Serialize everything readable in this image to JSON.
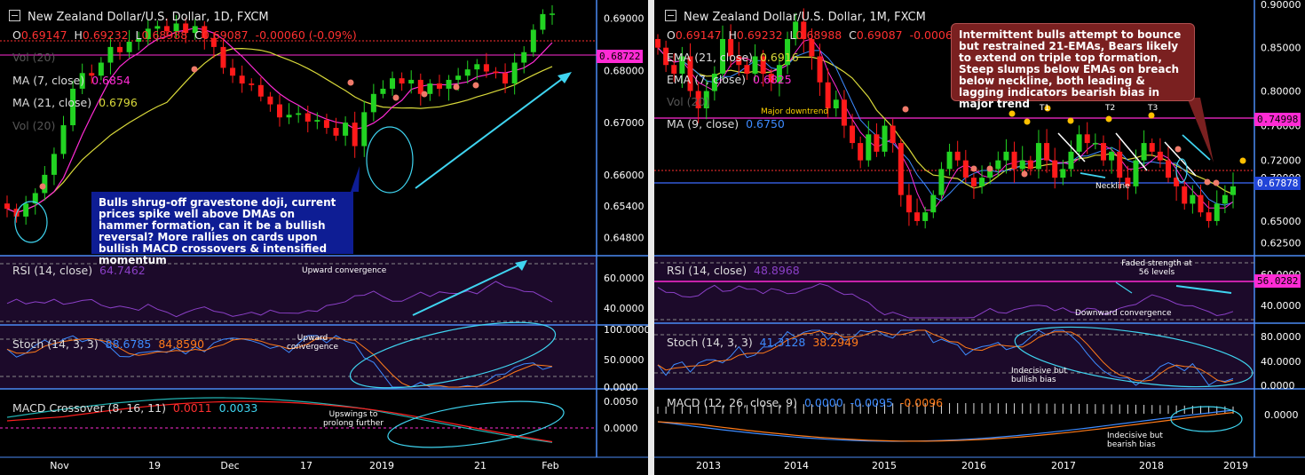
{
  "left": {
    "title": "New Zealand Dollar/U.S. Dollar, 1D, FXCM",
    "ohlc": {
      "o": "0.69147",
      "h": "0.69232",
      "l": "0.68988",
      "c": "0.69087",
      "chg": "-0.00060 (-0.09%)"
    },
    "indicators": {
      "vol": "Vol (20)",
      "ma7": "MA (7, close)",
      "ma7_val": "0.6854",
      "ma21": "MA (21, close)",
      "ma21_val": "0.6796",
      "vol2": "Vol (20)"
    },
    "price_tag": "0.68722",
    "note": "Bulls shrug-off gravestone doji, current prices spike well above DMAs on hammer formation, can it be a bullish reversal? More rallies on cards upon bullish MACD crossovers & intensified momentum",
    "rsi": {
      "label": "RSI (14, close)",
      "value": "64.7462",
      "ann": "Upward convergence"
    },
    "stoch": {
      "label": "Stoch (14, 3, 3)",
      "k": "88.6785",
      "d": "84.8590",
      "ann": "Upward convergence"
    },
    "macd": {
      "label": "MACD Crossover (8, 16, 11)",
      "v1": "0.0011",
      "v2": "0.0033",
      "ann": "Upswings to prolong further"
    },
    "price_ticks": [
      "0.69000",
      "0.68000",
      "0.67000",
      "0.66000",
      "0.65400",
      "0.64800"
    ],
    "rsi_ticks": [
      "60.0000",
      "40.0000"
    ],
    "stoch_ticks": [
      "100.0000",
      "50.0000",
      "0.0000"
    ],
    "macd_ticks": [
      "0.0050",
      "0.0000"
    ],
    "x_ticks": [
      "Nov",
      "19",
      "Dec",
      "17",
      "2019",
      "21",
      "Feb"
    ],
    "colors": {
      "bull": "#22d322",
      "bear": "#ff1a1a",
      "ma7": "#ff2bd4",
      "ma21": "#d9d93a",
      "rsi": "#8a3fc6",
      "stochk": "#3d8bff",
      "stochd": "#ff7b1a",
      "arrow": "#3fd4f0"
    }
  },
  "right": {
    "title": "New Zealand Dollar/U.S. Dollar, 1M, FXCM",
    "ohlc": {
      "o": "0.69147",
      "h": "0.69232",
      "l": "0.68988",
      "c": "0.69087",
      "chg": "-0.00060 (-0.09%)"
    },
    "indicators": {
      "ema21": "EMA (21, close)",
      "ema21_val": "0.6916",
      "ema7": "EMA (7, close)",
      "ema7_val": "0.6825",
      "vol": "Vol (20)",
      "ma9": "MA (9, close)",
      "ma9_val": "0.6750"
    },
    "price_tag": "0.74998",
    "price_tag2": "0.67878",
    "note": "Intermittent bulls attempt to bounce but restrained 21-EMAs, Bears likely to extend on triple top formation, Steep slumps below EMAs on breach below neckline, both leading & lagging indicators bearish bias in major trend",
    "labels": {
      "downtrend": "Major downtrend",
      "neckline": "Neckline",
      "t1": "T1",
      "t2": "T2",
      "t3": "T3"
    },
    "rsi": {
      "label": "RSI (14, close)",
      "value": "48.8968",
      "ann1": "Faded strength at 56 levels",
      "ann2": "Downward convergence",
      "tag": "56.0282"
    },
    "stoch": {
      "label": "Stoch (14, 3, 3)",
      "k": "41.3128",
      "d": "38.2949",
      "ann": "Indecisive but bullish bias"
    },
    "macd": {
      "label": "MACD (12, 26, close, 9)",
      "v1": "0.0000",
      "v2": "-0.0095",
      "v3": "-0.0096",
      "ann": "Indecisive but bearish bias"
    },
    "price_ticks": [
      "0.90000",
      "0.85000",
      "0.80000",
      "0.76000",
      "0.72000",
      "0.70000",
      "0.65000",
      "0.62500"
    ],
    "rsi_ticks": [
      "60.0000",
      "40.0000"
    ],
    "stoch_ticks": [
      "80.0000",
      "40.0000",
      "0.0000"
    ],
    "macd_ticks": [
      "0.0000"
    ],
    "x_ticks": [
      "2013",
      "2014",
      "2015",
      "2016",
      "2017",
      "2018",
      "2019"
    ]
  },
  "chart_data": [
    {
      "type": "candlestick",
      "title": "New Zealand Dollar/U.S. Dollar, 1D, FXCM",
      "x": [
        "Nov",
        "19",
        "Dec",
        "17",
        "2019",
        "21",
        "Feb"
      ],
      "series": [
        {
          "name": "MA (7, close)",
          "last": 0.6854
        },
        {
          "name": "MA (21, close)",
          "last": 0.6796
        }
      ],
      "close_path": [
        0.6535,
        0.652,
        0.6545,
        0.6565,
        0.66,
        0.664,
        0.6695,
        0.6765,
        0.6795,
        0.679,
        0.6815,
        0.6845,
        0.6835,
        0.6855,
        0.686,
        0.688,
        0.6885,
        0.6875,
        0.689,
        0.6872,
        0.6885,
        0.6862,
        0.6845,
        0.6805,
        0.679,
        0.6775,
        0.6772,
        0.675,
        0.6735,
        0.671,
        0.6715,
        0.6718,
        0.6702,
        0.6705,
        0.669,
        0.6675,
        0.67,
        0.6655,
        0.672,
        0.6755,
        0.6765,
        0.6785,
        0.6775,
        0.6782,
        0.6755,
        0.6775,
        0.6765,
        0.6782,
        0.679,
        0.6802,
        0.6812,
        0.6798,
        0.6795,
        0.6775,
        0.6815,
        0.6835,
        0.6878,
        0.6908,
        0.6909
      ],
      "ylim": [
        0.6445,
        0.6935
      ]
    },
    {
      "type": "candlestick",
      "title": "New Zealand Dollar/U.S. Dollar, 1M, FXCM",
      "x": [
        "2013",
        "2014",
        "2015",
        "2016",
        "2017",
        "2018",
        "2019"
      ],
      "series": [
        {
          "name": "EMA (21, close)",
          "last": 0.6916
        },
        {
          "name": "EMA (7, close)",
          "last": 0.6825
        },
        {
          "name": "MA (9, close)",
          "last": 0.675
        }
      ],
      "close_path": [
        0.85,
        0.83,
        0.82,
        0.84,
        0.8,
        0.78,
        0.8,
        0.82,
        0.86,
        0.84,
        0.83,
        0.82,
        0.84,
        0.82,
        0.81,
        0.83,
        0.86,
        0.88,
        0.86,
        0.84,
        0.81,
        0.78,
        0.79,
        0.76,
        0.74,
        0.72,
        0.75,
        0.73,
        0.76,
        0.74,
        0.68,
        0.66,
        0.65,
        0.66,
        0.68,
        0.71,
        0.73,
        0.72,
        0.7,
        0.69,
        0.7,
        0.71,
        0.72,
        0.73,
        0.71,
        0.72,
        0.71,
        0.74,
        0.72,
        0.7,
        0.71,
        0.73,
        0.75,
        0.74,
        0.74,
        0.72,
        0.73,
        0.7,
        0.69,
        0.72,
        0.74,
        0.73,
        0.72,
        0.7,
        0.69,
        0.67,
        0.68,
        0.66,
        0.65,
        0.67,
        0.68,
        0.69
      ],
      "ylim": [
        0.61,
        0.905
      ]
    },
    {
      "type": "line",
      "title": "RSI (14, close)",
      "values_end": [
        64.7462,
        48.8968
      ]
    },
    {
      "type": "line",
      "title": "Stoch (14, 3, 3)",
      "values_end": [
        [
          88.6785,
          84.859
        ],
        [
          41.3128,
          38.2949
        ]
      ]
    },
    {
      "type": "line",
      "title": "MACD",
      "values_end": [
        [
          0.0011,
          0.0033
        ],
        [
          0.0,
          -0.0095,
          -0.0096
        ]
      ]
    }
  ]
}
